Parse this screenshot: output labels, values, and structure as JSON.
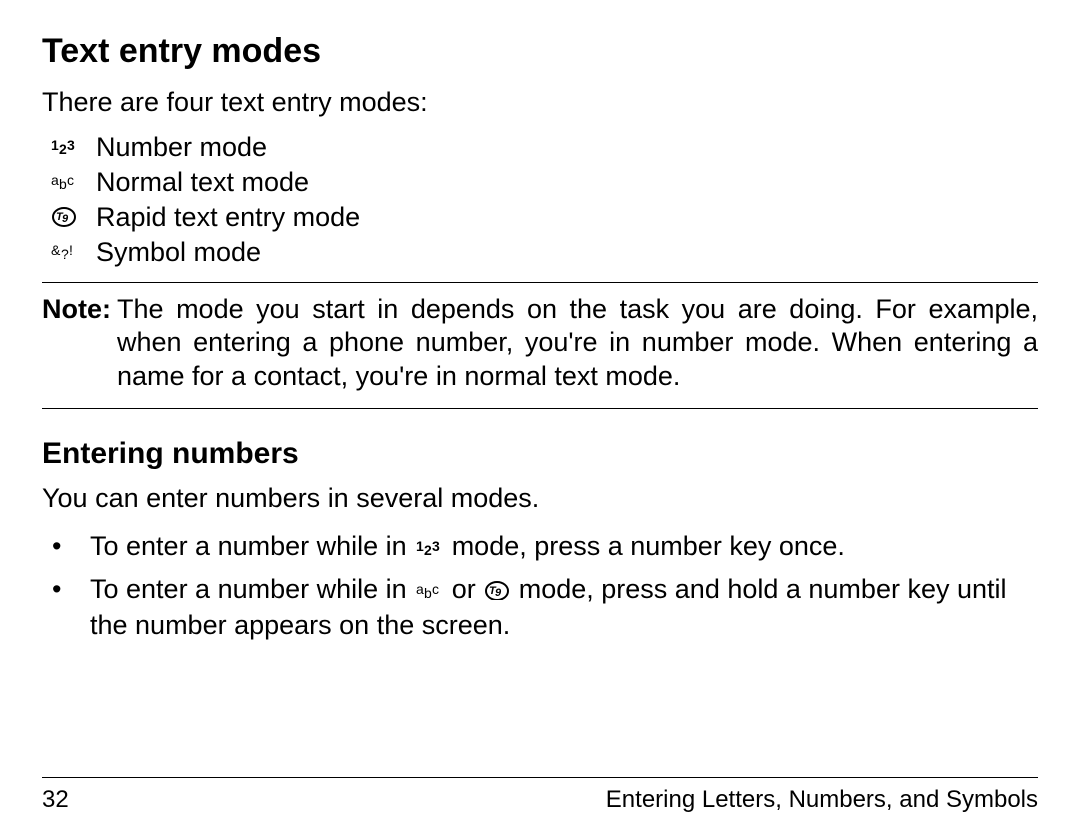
{
  "section_title": "Text entry modes",
  "intro": "There are four text entry modes:",
  "modes": [
    {
      "icon": "num-icon",
      "label": "Number mode"
    },
    {
      "icon": "abc-icon",
      "label": "Normal text mode"
    },
    {
      "icon": "t9-icon",
      "label": "Rapid text entry mode"
    },
    {
      "icon": "sym-icon",
      "label": "Symbol mode"
    }
  ],
  "note_label": "Note:",
  "note_text": "The mode you start in depends on the task you are doing. For example, when entering a phone number, you're in number mode. When entering a name for a contact, you're in normal text mode.",
  "subsection_title": "Entering numbers",
  "sub_intro": "You can enter numbers in several modes.",
  "bullets": {
    "b1_a": "To enter a number while in ",
    "b1_b": " mode, press a number key once.",
    "b2_a": "To enter a number while in ",
    "b2_b": " or ",
    "b2_c": " mode, press and hold a number key until the number appears on the screen."
  },
  "footer": {
    "page": "32",
    "chapter": "Entering Letters, Numbers, and Symbols"
  }
}
